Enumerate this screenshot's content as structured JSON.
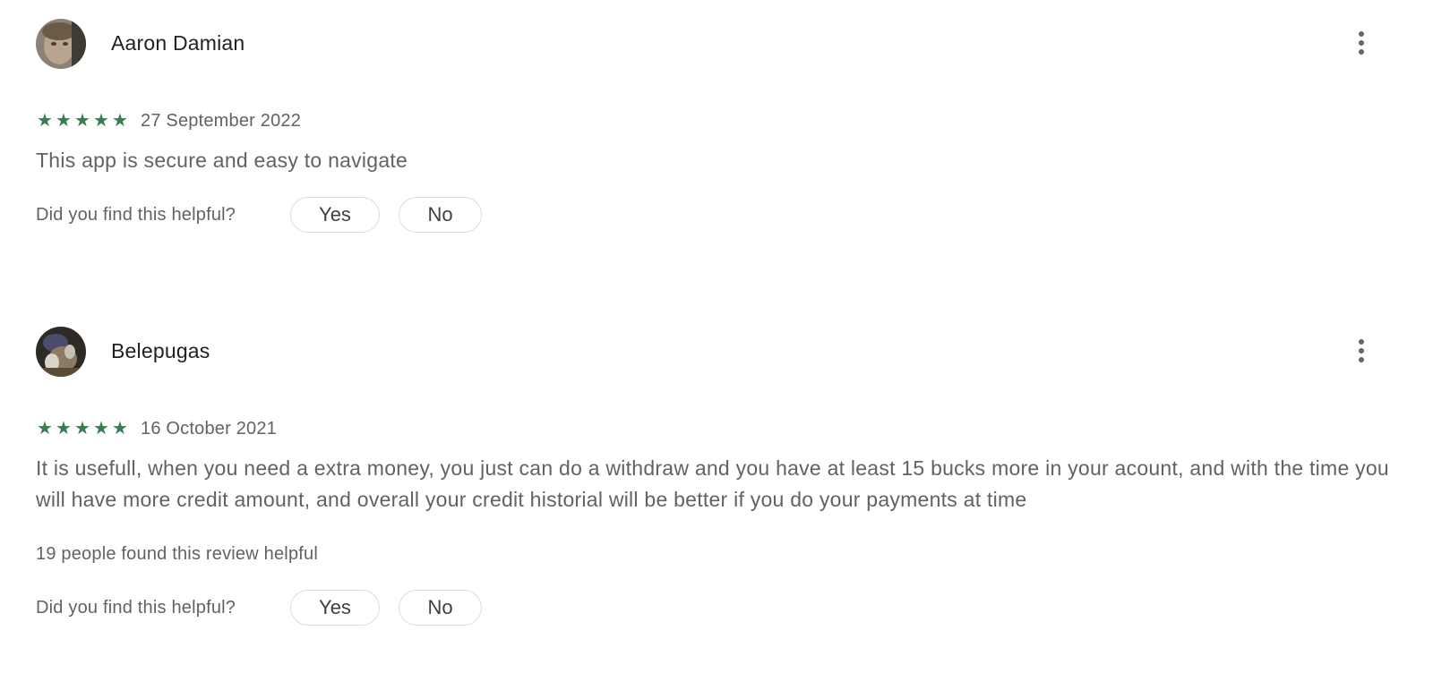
{
  "reviews": [
    {
      "author": "Aaron Damian",
      "avatar": "avatar-photo",
      "rating": 5,
      "stars": [
        "★",
        "★",
        "★",
        "★",
        "★"
      ],
      "date": "27 September 2022",
      "text": "This app is secure and easy to navigate",
      "helpful_count": "",
      "helpful_prompt": "Did you find this helpful?",
      "yes_label": "Yes",
      "no_label": "No",
      "more_icon": "more-vert-icon"
    },
    {
      "author": "Belepugas",
      "avatar": "avatar-photo",
      "rating": 5,
      "stars": [
        "★",
        "★",
        "★",
        "★",
        "★"
      ],
      "date": "16 October 2021",
      "text": "It is usefull, when you need a extra money, you just can do a withdraw and you have at least 15 bucks more in your acount, and with the time you will have more credit amount, and overall your credit historial will be better if you do your payments at time",
      "helpful_count": "19 people found this review helpful",
      "helpful_prompt": "Did you find this helpful?",
      "yes_label": "Yes",
      "no_label": "No",
      "more_icon": "more-vert-icon"
    }
  ],
  "colors": {
    "star": "#3c7a53",
    "text_primary": "#202124",
    "text_secondary": "#5f6368",
    "button_border": "#dadce0"
  }
}
